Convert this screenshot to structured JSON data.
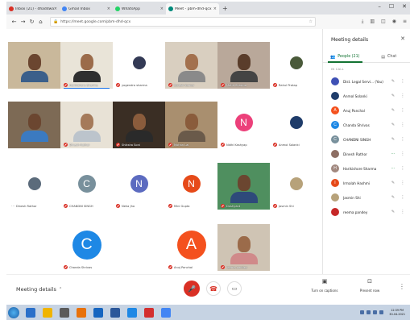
{
  "browser": {
    "tabs": [
      {
        "title": "Inbox (21) - dhaddwal@gmail.c",
        "color": "#d93025",
        "active": false
      },
      {
        "title": "Gmail Inbox",
        "color": "#4285f4",
        "active": false
      },
      {
        "title": "WhatsApp",
        "color": "#25d366",
        "active": false
      },
      {
        "title": "Meet - pbm-dhd-qcx",
        "color": "#00897b",
        "active": true
      }
    ],
    "new_tab": "+",
    "url": "https://meet.google.com/pbm-dhd-qcx"
  },
  "tiles": [
    {
      "name": "",
      "row": 0,
      "col": 0,
      "kind": "video",
      "bg": "#c9b89b",
      "skin": "#6b4630",
      "shirt": "#3b5f8a"
    },
    {
      "name": "Harikishore Sharma",
      "row": 0,
      "col": 1,
      "kind": "video",
      "bg": "#e9e4d8",
      "skin": "#9b6b4a",
      "shirt": "#2f2f2f",
      "active": true
    },
    {
      "name": "yogendra sharma",
      "row": 0,
      "col": 2,
      "kind": "avatar_img",
      "bg": "#ffffff",
      "avatar_color": "#333a55",
      "letter": ""
    },
    {
      "name": "Suresh Kumar",
      "row": 0,
      "col": 3,
      "kind": "video",
      "bg": "#d9cfc0",
      "skin": "#a3714e",
      "shirt": "#8a8a8a"
    },
    {
      "name": "Mohit Sharma",
      "row": 0,
      "col": 4,
      "kind": "video",
      "bg": "#b9a89a",
      "skin": "#5a3d2b",
      "shirt": "#444444"
    },
    {
      "name": "Rahul Pratap",
      "row": 0,
      "col": 5,
      "kind": "avatar_img",
      "bg": "#ffffff",
      "avatar_color": "#4a5a3a",
      "letter": ""
    },
    {
      "name": "",
      "row": 1,
      "col": 0,
      "kind": "video",
      "bg": "#7d6a55",
      "skin": "#6b4630",
      "shirt": "#3b7ac0"
    },
    {
      "name": "Dinesh Rathor",
      "row": 1,
      "col": 1,
      "kind": "video",
      "bg": "#e8e2d6",
      "skin": "#a57a5a",
      "shirt": "#bcc4cc"
    },
    {
      "name": "Shiksha Soni",
      "row": 1,
      "col": 2,
      "kind": "video",
      "bg": "#3a2e24",
      "skin": "#8a5c3c",
      "shirt": "#2a2a2a"
    },
    {
      "name": "Mohan Lal",
      "row": 1,
      "col": 3,
      "kind": "video",
      "bg": "#a98f6f",
      "skin": "#8a5c3c",
      "shirt": "#6a5a4a"
    },
    {
      "name": "Nidhi Kashyap",
      "row": 1,
      "col": 4,
      "kind": "avatar",
      "bg": "#ffffff",
      "avatar_color": "#ec407a",
      "letter": "N"
    },
    {
      "name": "Anmol Solanki",
      "row": 1,
      "col": 5,
      "kind": "avatar_img",
      "bg": "#ffffff",
      "avatar_color": "#1f3c6a",
      "letter": ""
    },
    {
      "name": "Dinesh Rathor",
      "row": 2,
      "col": 0,
      "kind": "avatar_img",
      "bg": "#ffffff",
      "avatar_color": "#5b6b7b",
      "letter": "",
      "dots": true
    },
    {
      "name": "CHANDNI SINGH",
      "row": 2,
      "col": 1,
      "kind": "avatar",
      "bg": "#ffffff",
      "avatar_color": "#78909c",
      "letter": "C"
    },
    {
      "name": "Neha Jha",
      "row": 2,
      "col": 2,
      "kind": "avatar",
      "bg": "#ffffff",
      "avatar_color": "#5c6bc0",
      "letter": "N"
    },
    {
      "name": "Mini Gupta",
      "row": 2,
      "col": 3,
      "kind": "avatar",
      "bg": "#ffffff",
      "avatar_color": "#e64a19",
      "letter": "N"
    },
    {
      "name": "Dushyant",
      "row": 2,
      "col": 4,
      "kind": "video",
      "bg": "#4f8f5f",
      "skin": "#6b4630",
      "shirt": "#2e4a7a"
    },
    {
      "name": "Jasmin Shi",
      "row": 2,
      "col": 5,
      "kind": "avatar_img",
      "bg": "#ffffff",
      "avatar_color": "#b7a27a",
      "letter": ""
    },
    {
      "name": "Chanda Shrivas",
      "row": 3,
      "col": 1,
      "kind": "avatar",
      "bg": "#ffffff",
      "avatar_color": "#1e88e5",
      "letter": "C",
      "big": true
    },
    {
      "name": "Anuj Panchal",
      "row": 3,
      "col": 3,
      "kind": "avatar",
      "bg": "#ffffff",
      "avatar_color": "#f4511e",
      "letter": "A",
      "big": true
    },
    {
      "name": "reema pandey",
      "row": 3,
      "col": 4,
      "kind": "video",
      "bg": "#cfc4b4",
      "skin": "#9b6b4a",
      "shirt": "#d08a8a"
    }
  ],
  "bottom": {
    "meeting_details": "Meeting details",
    "captions_label": "Turn on captions",
    "present_label": "Present now"
  },
  "panel": {
    "title": "Meeting details",
    "tab_people": "People (21)",
    "tab_chat": "Chat",
    "section": "IN CALL",
    "participants": [
      {
        "name": "Dist. Legal Servi... (You)",
        "color": "#3f51b5",
        "letter": "",
        "mic": "off"
      },
      {
        "name": "Anmol Solanki",
        "color": "#1f3c6a",
        "letter": "",
        "mic": "off"
      },
      {
        "name": "Anuj Panchal",
        "color": "#f4511e",
        "letter": "A",
        "mic": "off"
      },
      {
        "name": "Chanda Shrivas",
        "color": "#1e88e5",
        "letter": "C",
        "mic": "off"
      },
      {
        "name": "CHANDNI SINGH",
        "color": "#78909c",
        "letter": "C",
        "mic": "off"
      },
      {
        "name": "Dinesh Rathor",
        "color": "#8d6e63",
        "letter": "",
        "mic": "on"
      },
      {
        "name": "Harikishore Sharma",
        "color": "#a1887f",
        "letter": "H",
        "mic": "on"
      },
      {
        "name": "Irmalah Hashmi",
        "color": "#e64a19",
        "letter": "I",
        "mic": "off"
      },
      {
        "name": "Jasmin Shi",
        "color": "#b7a27a",
        "letter": "",
        "mic": "off"
      },
      {
        "name": "reema pandey",
        "color": "#c62828",
        "letter": "",
        "mic": "off"
      }
    ]
  },
  "taskbar": {
    "icons": [
      "#2a6fc9",
      "#f0b400",
      "#5a5a5a",
      "#e8710a",
      "#1565c0",
      "#2b579a",
      "#1e88e5",
      "#d32f2f",
      "#4285f4"
    ],
    "time": "12:39 PM",
    "date": "30-04-2021"
  }
}
